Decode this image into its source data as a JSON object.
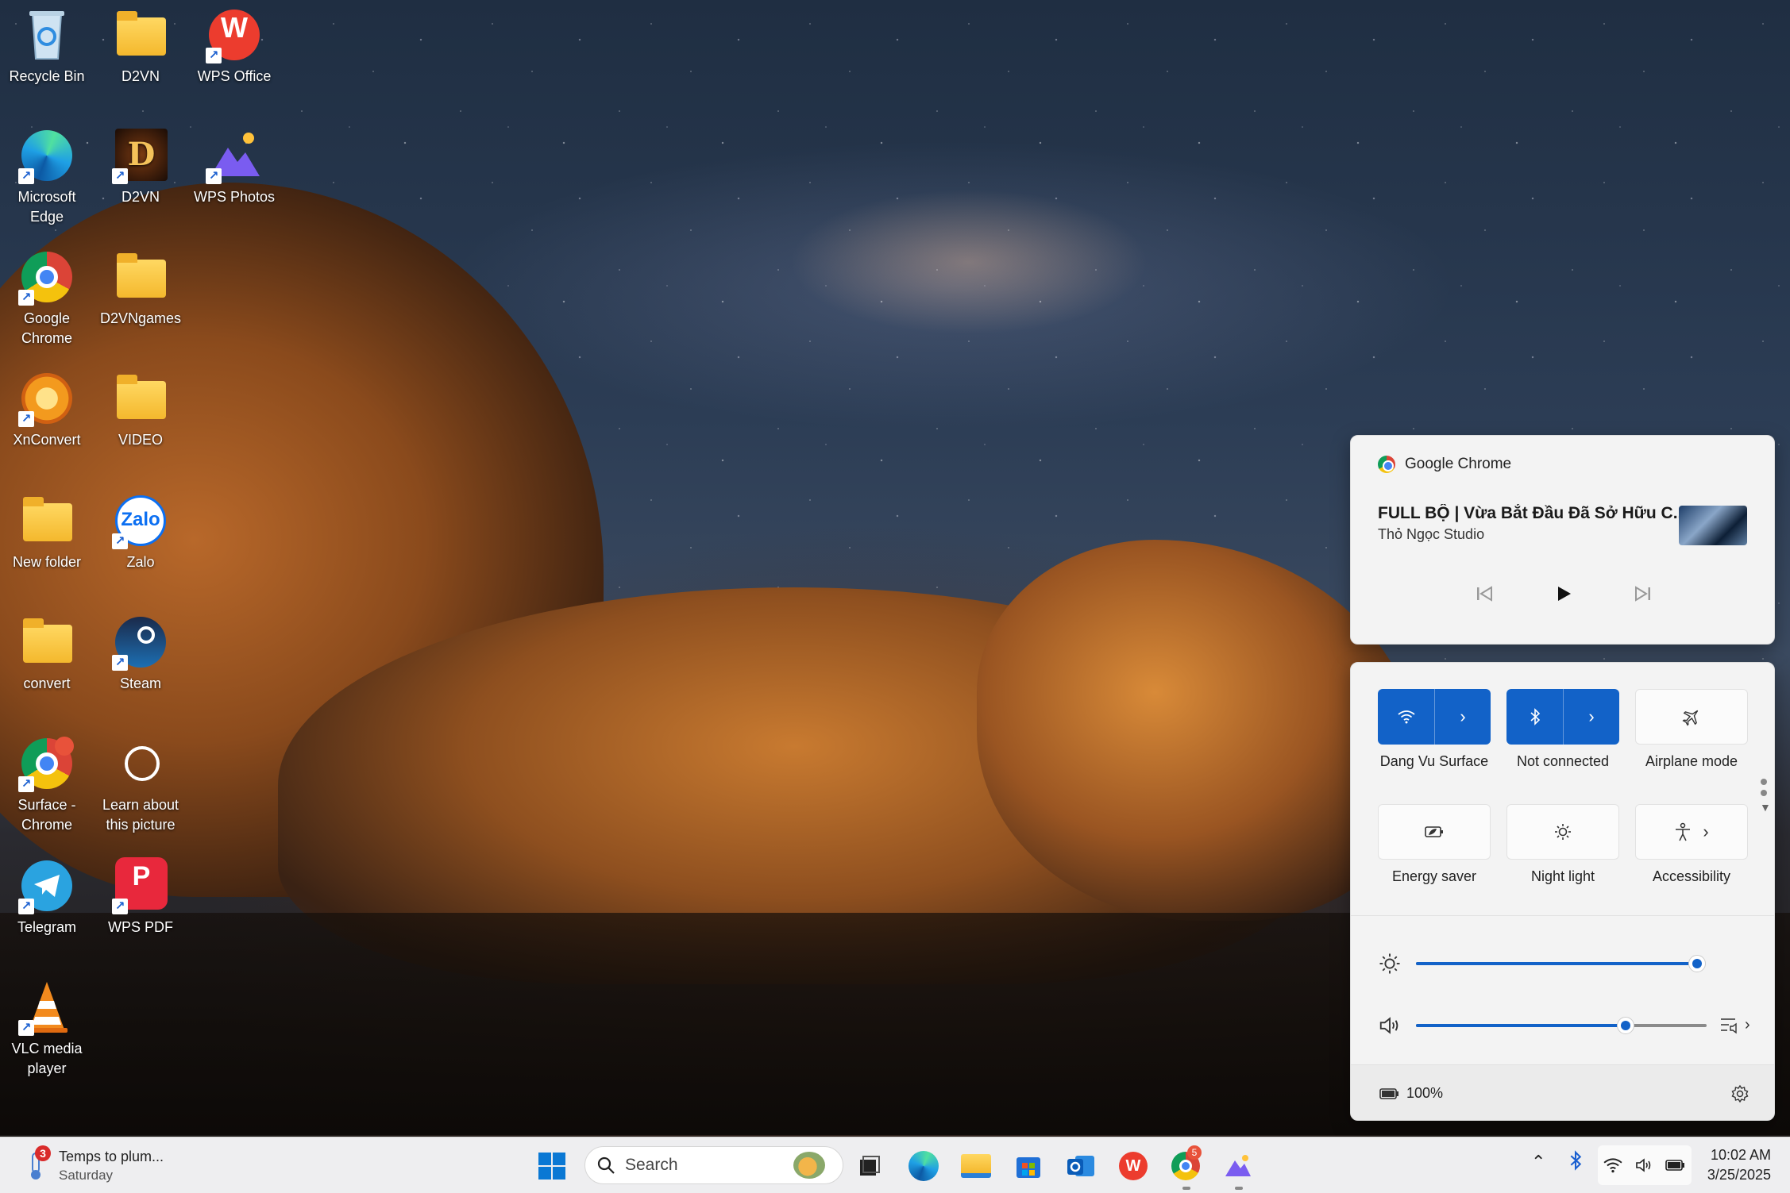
{
  "desktop": {
    "icons": [
      {
        "label": "Recycle Bin",
        "icon": "recycle-bin-icon"
      },
      {
        "label": "D2VN",
        "icon": "folder-icon"
      },
      {
        "label": "WPS Office",
        "icon": "wps-office-icon"
      },
      {
        "label": "Microsoft Edge",
        "icon": "edge-icon"
      },
      {
        "label": "D2VN",
        "icon": "d2vn-game-icon"
      },
      {
        "label": "WPS Photos",
        "icon": "wps-photos-icon"
      },
      {
        "label": "Google Chrome",
        "icon": "chrome-icon"
      },
      {
        "label": "D2VNgames",
        "icon": "folder-icon"
      },
      {
        "label": "XnConvert",
        "icon": "xnconvert-icon"
      },
      {
        "label": "VIDEO",
        "icon": "folder-icon"
      },
      {
        "label": "New folder",
        "icon": "folder-icon"
      },
      {
        "label": "Zalo",
        "icon": "zalo-icon"
      },
      {
        "label": "convert",
        "icon": "folder-icon"
      },
      {
        "label": "Steam",
        "icon": "steam-icon"
      },
      {
        "label": "Surface - Chrome",
        "icon": "chrome-profile-icon"
      },
      {
        "label": "Learn about this picture",
        "icon": "learn-picture-icon"
      },
      {
        "label": "Telegram",
        "icon": "telegram-icon"
      },
      {
        "label": "WPS PDF",
        "icon": "wps-pdf-icon"
      },
      {
        "label": "VLC media player",
        "icon": "vlc-icon"
      }
    ]
  },
  "media": {
    "app": "Google Chrome",
    "title": "FULL BỘ | Vừa Bắt Đầu Đã Sở Hữu C...",
    "artist": "Thỏ Ngọc Studio"
  },
  "quick_settings": {
    "tiles": [
      {
        "label": "Dang Vu Surface",
        "icon": "wifi-icon",
        "state": "on"
      },
      {
        "label": "Not connected",
        "icon": "bluetooth-icon",
        "state": "on"
      },
      {
        "label": "Airplane mode",
        "icon": "airplane-icon",
        "state": "off"
      },
      {
        "label": "Energy saver",
        "icon": "energy-saver-icon",
        "state": "off"
      },
      {
        "label": "Night light",
        "icon": "night-light-icon",
        "state": "off"
      },
      {
        "label": "Accessibility",
        "icon": "accessibility-icon",
        "state": "off"
      }
    ],
    "brightness_percent": 100,
    "volume_percent": 72,
    "battery": "100%",
    "accent": "#1262c8"
  },
  "taskbar": {
    "weather": {
      "text": "Temps to plum...",
      "day": "Saturday",
      "badge": "3"
    },
    "search_placeholder": "Search",
    "chrome_badge": "5",
    "clock": {
      "time": "10:02 AM",
      "date": "3/25/2025"
    }
  }
}
